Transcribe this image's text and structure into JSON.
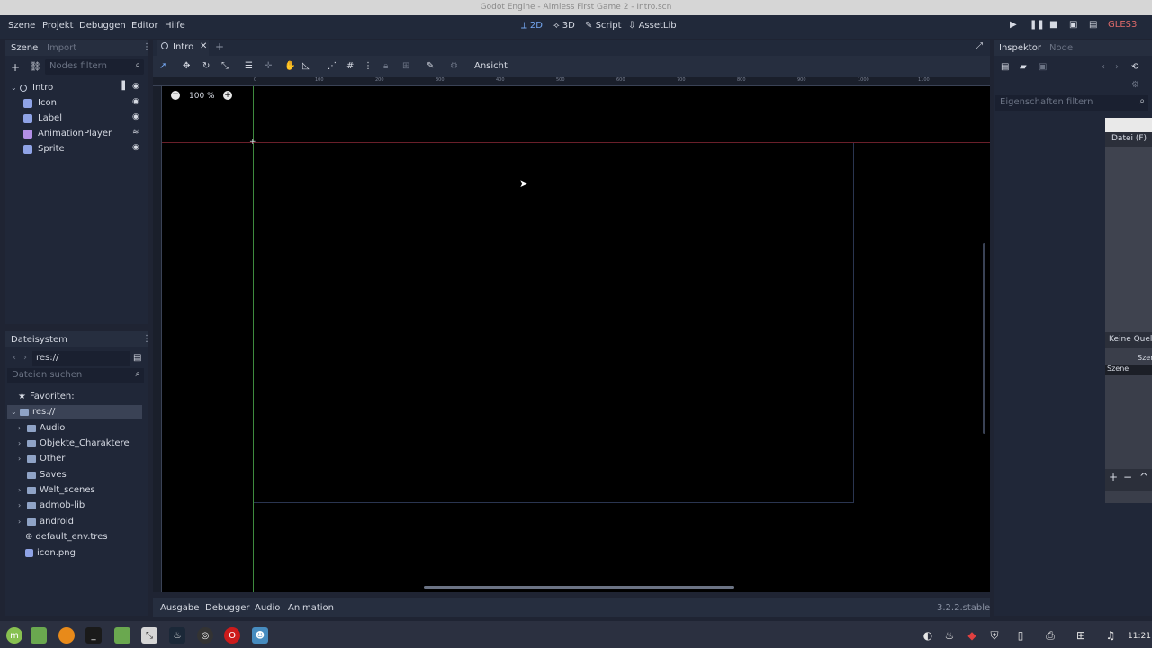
{
  "window": {
    "title": "Godot Engine - Aimless First Game 2 - Intro.scn"
  },
  "menu": {
    "scene": "Szene",
    "project": "Projekt",
    "debug": "Debuggen",
    "editor": "Editor",
    "help": "Hilfe"
  },
  "workspaces": {
    "w2d": "2D",
    "w3d": "3D",
    "script": "Script",
    "assetlib": "AssetLib"
  },
  "renderer": "GLES3",
  "scene_dock": {
    "tab_scene": "Szene",
    "tab_import": "Import",
    "filter_placeholder": "Nodes filtern",
    "nodes": [
      {
        "label": "Intro",
        "color": "#c0c8d8"
      },
      {
        "label": "Icon",
        "color": "#8fa3e6"
      },
      {
        "label": "Label",
        "color": "#8fa3e6"
      },
      {
        "label": "AnimationPlayer",
        "color": "#b38fe6"
      },
      {
        "label": "Sprite",
        "color": "#8fa3e6"
      }
    ]
  },
  "filesystem": {
    "tab": "Dateisystem",
    "path": "res://",
    "search_placeholder": "Dateien suchen",
    "favorites": "Favoriten:",
    "root": "res://",
    "items": [
      "Audio",
      "Objekte_Charaktere",
      "Other",
      "Saves",
      "Welt_scenes",
      "admob-lib",
      "android",
      "default_env.tres",
      "icon.png"
    ]
  },
  "editor_tab": {
    "label": "Intro"
  },
  "toolbar": {
    "view": "Ansicht"
  },
  "zoom": "100 %",
  "ruler_labels": [
    "0",
    "100",
    "200",
    "300",
    "400",
    "500",
    "600",
    "700",
    "800",
    "900",
    "1000",
    "1100"
  ],
  "bottom_tabs": {
    "output": "Ausgabe",
    "debugger": "Debugger",
    "audio": "Audio",
    "animation": "Animation"
  },
  "version": "3.2.2.stable",
  "inspector": {
    "tab_inspector": "Inspektor",
    "tab_node": "Node",
    "filter_placeholder": "Eigenschaften filtern"
  },
  "overlay": {
    "menu_file": "Datei (F)",
    "no_source": "Keine Quelle",
    "scene_label1": "Szen",
    "scene_label2": "Szene"
  },
  "clock": "11:21"
}
